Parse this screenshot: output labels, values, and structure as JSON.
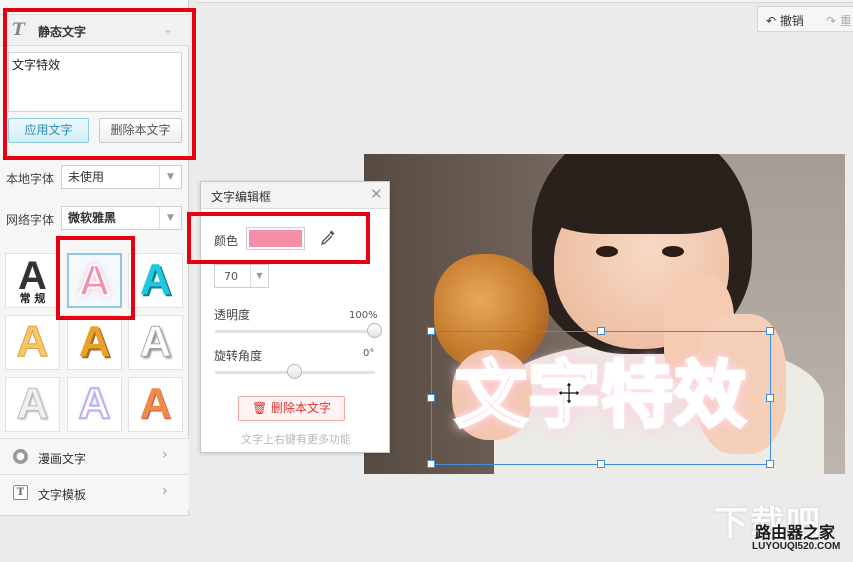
{
  "left_panel": {
    "header_icon": "T",
    "header_title": "静态文字",
    "text_value": "文字特效",
    "apply_button": "应用文字",
    "delete_button": "删除本文字",
    "local_font_label": "本地字体",
    "local_font_value": "未使用",
    "web_font_label": "网络字体",
    "web_font_value": "微软雅黑",
    "style_tiles": [
      {
        "glyph": "A",
        "sub": "常 规",
        "color": "#333333"
      },
      {
        "glyph": "A",
        "sub": "",
        "color": "#f58ea8"
      },
      {
        "glyph": "A",
        "sub": "",
        "color": "#1fc8df"
      },
      {
        "glyph": "A",
        "sub": "",
        "color": "#f2b84b"
      },
      {
        "glyph": "A",
        "sub": "",
        "color": "#e8a22c"
      },
      {
        "glyph": "A",
        "sub": "",
        "color": "#ffffff"
      },
      {
        "glyph": "A",
        "sub": "",
        "color": "#f0f0f0"
      },
      {
        "glyph": "A",
        "sub": "",
        "color": "#c9a8f0"
      },
      {
        "glyph": "A",
        "sub": "",
        "color": "#f08a4b"
      }
    ],
    "menu": [
      {
        "label": "漫画文字",
        "icon": "comic-bubble-icon"
      },
      {
        "label": "文字模板",
        "icon": "text-template-icon"
      }
    ]
  },
  "toolbar": {
    "undo_label": "撤销",
    "redo_label": "重"
  },
  "dialog": {
    "title": "文字编辑框",
    "color_label": "颜色",
    "color_value": "#f58ea8",
    "size_value": "70",
    "opacity_label": "透明度",
    "opacity_value": "100%",
    "opacity_level": 1.0,
    "rotation_label": "旋转角度",
    "rotation_value": "0°",
    "rotation_level": 0.5,
    "delete_button": "删除本文字",
    "hint": "文字上右键有更多功能"
  },
  "canvas": {
    "effect_text": "文字特效"
  },
  "watermark": {
    "big": "下载吧",
    "main": "路由器之家",
    "url": "LUYOUQI520.COM"
  },
  "colors": {
    "highlight_red": "#e60012",
    "selection_blue": "#3e8ee6",
    "text_pink": "#f5a2b8"
  }
}
